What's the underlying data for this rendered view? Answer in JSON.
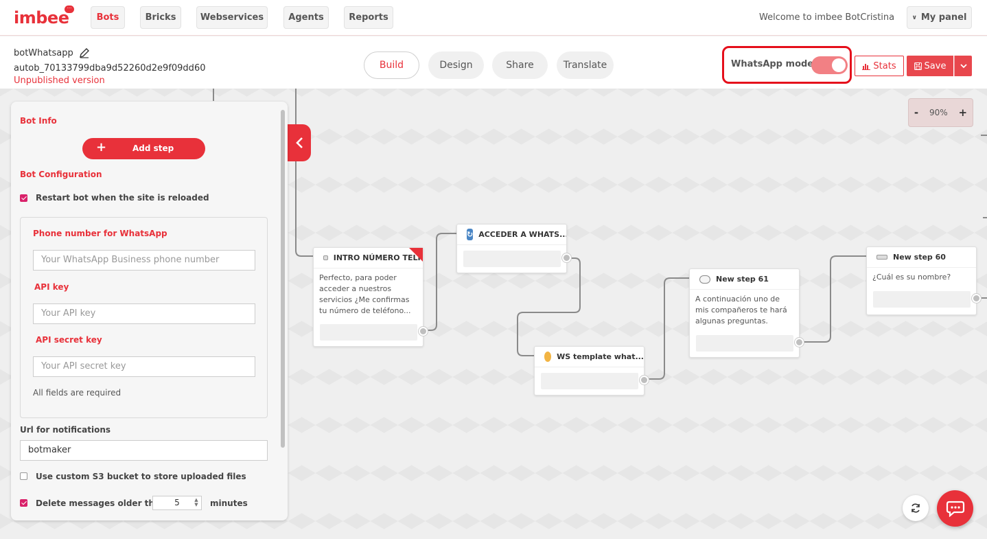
{
  "nav": {
    "logo": "imbee",
    "logo_badge": "···",
    "items": [
      {
        "label": "Bots",
        "active": true
      },
      {
        "label": "Bricks",
        "active": false
      },
      {
        "label": "Webservices",
        "active": false
      },
      {
        "label": "Agents",
        "active": false
      },
      {
        "label": "Reports",
        "active": false
      }
    ],
    "welcome": "Welcome to imbee BotCristina",
    "my_panel": "My panel"
  },
  "header": {
    "bot_name": "botWhatsapp",
    "bot_id": "autob_70133799dba9d52260d2e9f09dd60",
    "status": "Unpublished version",
    "tabs": [
      {
        "label": "Build",
        "active": true
      },
      {
        "label": "Design",
        "active": false
      },
      {
        "label": "Share",
        "active": false
      },
      {
        "label": "Translate",
        "active": false
      }
    ],
    "whatsapp_mode_label": "WhatsApp mode",
    "whatsapp_mode_on": true,
    "stats_label": "Stats",
    "save_label": "Save"
  },
  "canvas": {
    "zoom_minus": "-",
    "zoom_level": "90%",
    "zoom_plus": "+",
    "nodes": [
      {
        "title": "INTRO NÚMERO TELF",
        "text": "Perfecto, para poder acceder a nuestros servicios ¿Me confirmas tu número de teléfono..."
      },
      {
        "title": "ACCEDER A WHATS...",
        "text": ""
      },
      {
        "title": "WS template what...",
        "text": ""
      },
      {
        "title": "New step 61",
        "text": "A continuación uno de mis compañeros te hará algunas preguntas."
      },
      {
        "title": "New step 60",
        "text": "¿Cuál es su nombre?"
      }
    ]
  },
  "panel": {
    "bot_info": "Bot Info",
    "add_step": "Add step",
    "bot_configuration": "Bot Configuration",
    "restart_label": "Restart bot when the site is reloaded",
    "restart_checked": true,
    "phone_title": "Phone number for WhatsApp",
    "phone_placeholder": "Your WhatsApp Business phone number",
    "api_key_title": "API key",
    "api_key_placeholder": "Your API key",
    "api_secret_title": "API secret key",
    "api_secret_placeholder": "Your API secret key",
    "required_note": "All fields are required",
    "url_title": "Url for notifications",
    "url_value": "botmaker",
    "s3_label": "Use custom S3 bucket to store uploaded files",
    "s3_checked": false,
    "delete_label": "Delete messages older than",
    "delete_checked": true,
    "delete_value": "5",
    "delete_unit": "minutes"
  },
  "colors": {
    "brand": "#e8313a",
    "highlight": "#e50f1b",
    "toggle": "#f28084",
    "checkbox": "#d9216a"
  }
}
